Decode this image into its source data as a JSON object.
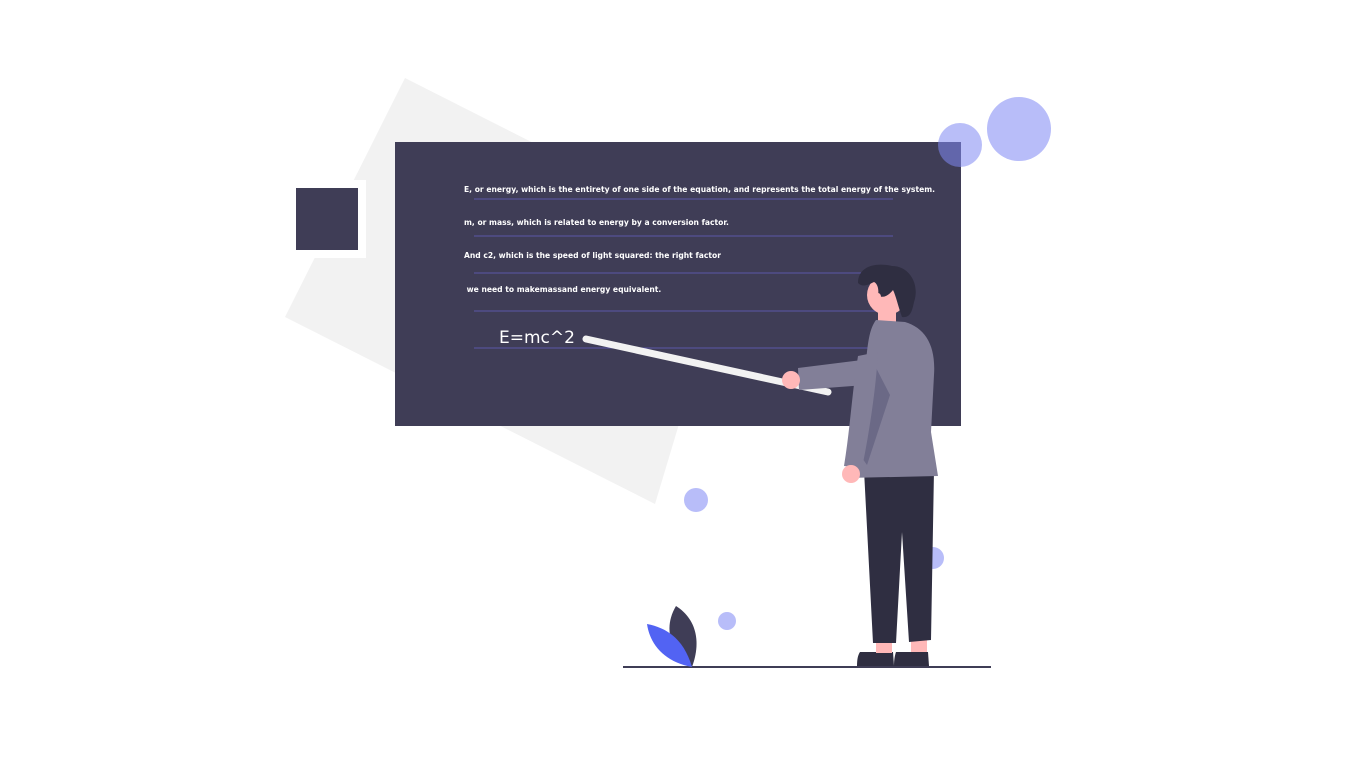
{
  "colors": {
    "background": "#ffffff",
    "board": "#3f3d56",
    "board_rule": "#5b57a8",
    "backdrop": "#f2f2f2",
    "accent_light": "#b8bdf9",
    "accent": "#5263f3",
    "accent_translucent": "#7f88f2",
    "jacket": "#827f98",
    "jacket_shadow": "#6b6986",
    "pants": "#2f2e41",
    "skin": "#ffb8b8",
    "hair": "#2f2e41",
    "pointer": "#f2f2f2",
    "ground": "#3f3d56"
  },
  "board": {
    "lines": [
      "E, or energy, which is the entirety of one side of the equation, and represents the total energy of the system.",
      "m, or mass, which is related to energy by a conversion factor.",
      "And c2, which is the speed of light squared: the right factor",
      " we need to makemassand energy equivalent."
    ],
    "formula": "E=mc^2"
  },
  "icons": {
    "teacher": "teacher-figure-icon",
    "plant": "leaf-plant-icon",
    "bubble": "bubble-icon"
  }
}
